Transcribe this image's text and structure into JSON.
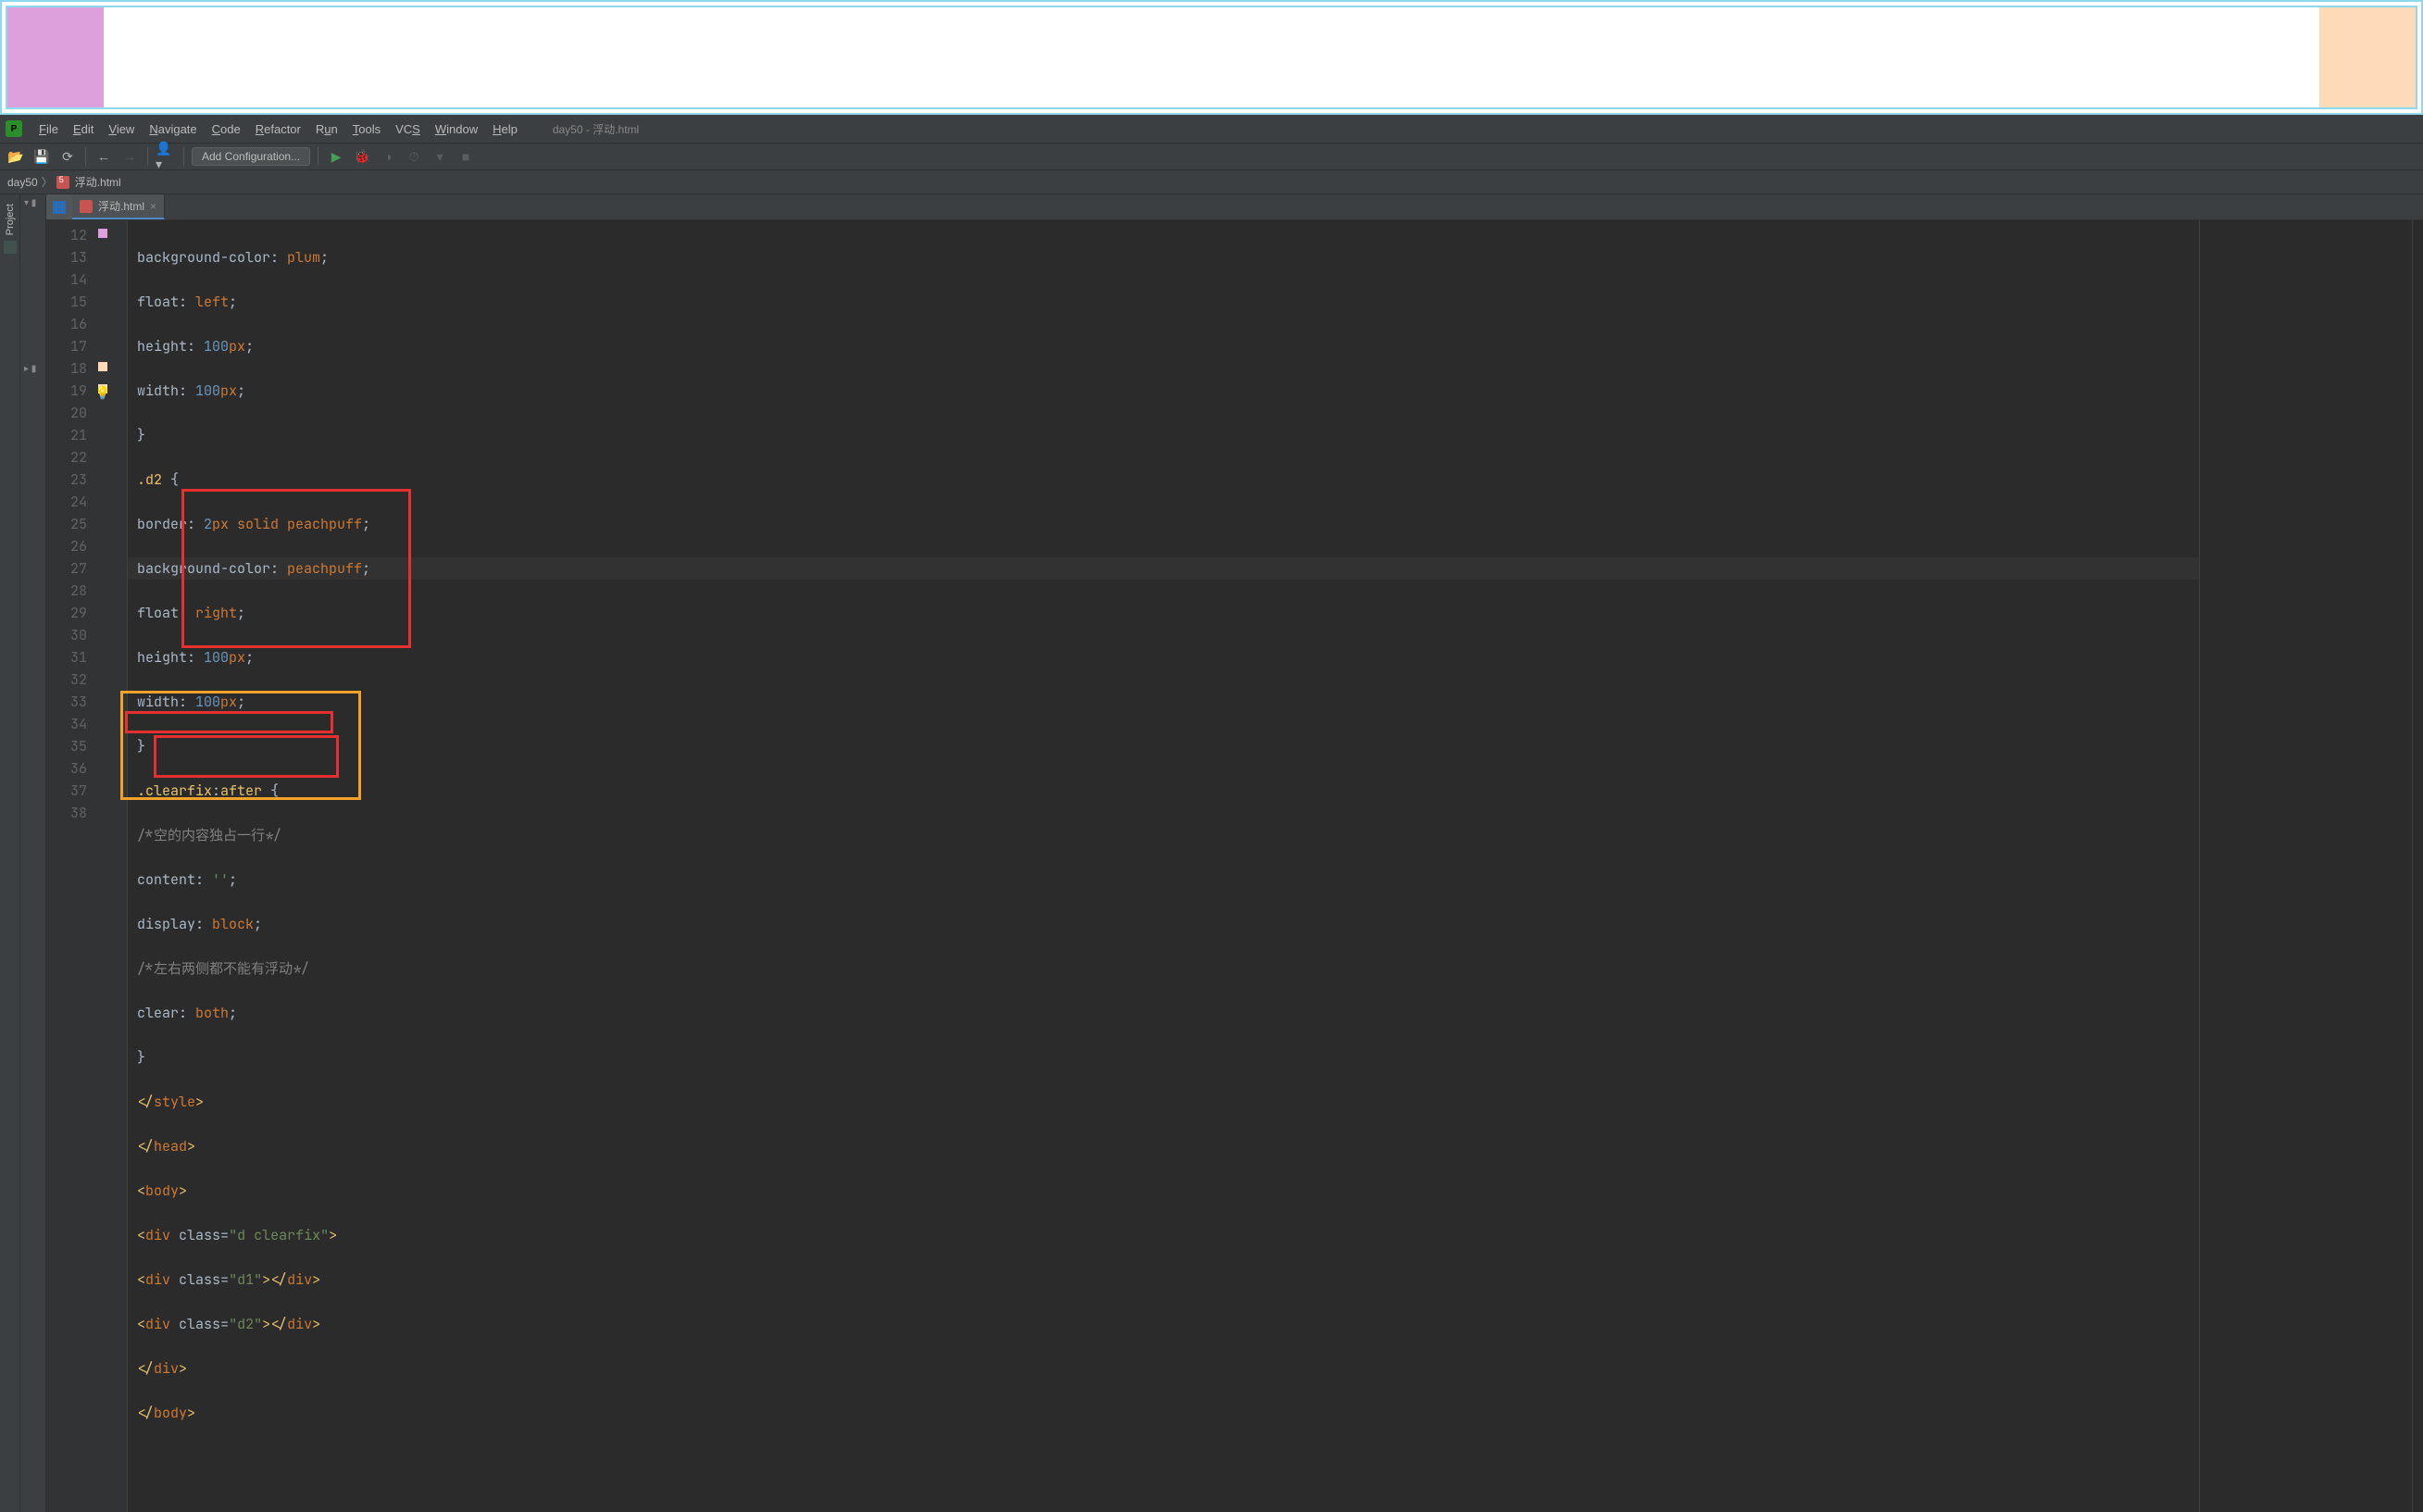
{
  "preview": {
    "plum_color": "#dda0dd",
    "peach_color": "#ffdab9"
  },
  "menubar": {
    "items": [
      "File",
      "Edit",
      "View",
      "Navigate",
      "Code",
      "Refactor",
      "Run",
      "Tools",
      "VCS",
      "Window",
      "Help"
    ],
    "title": "day50 - 浮动.html"
  },
  "toolbar": {
    "config_label": "Add Configuration..."
  },
  "breadcrumb": {
    "root": "day50",
    "file": "浮动.html"
  },
  "sidebar": {
    "project_label": "Project"
  },
  "tabs": {
    "active": "浮动.html"
  },
  "gutter": {
    "start": 12,
    "end": 38
  },
  "code": {
    "l12": "            background-color: plum;",
    "l13": "            float: left;",
    "l14": "            height: 100px;",
    "l15": "            width: 100px;",
    "l16": "        }",
    "l17": "        .d2 {",
    "l18": "            border: 2px solid peachpuff;",
    "l19": "            background-color: peachpuff;",
    "l20": "            float: right;",
    "l21": "            height: 100px;",
    "l22": "            width: 100px;",
    "l23": "        }",
    "l24": "        .clearfix:after {",
    "l25": "             /*空的内容独占一行*/",
    "l26": "             content: '';",
    "l27": "             display: block;",
    "l28": "             /*左右两侧都不能有浮动*/",
    "l29": "             clear: both;",
    "l30": "        }",
    "l31": "    </style>",
    "l32": "</head>",
    "l33": "<body>",
    "l34": "<div class=\"d clearfix\">",
    "l35": "    <div class=\"d1\"></div>",
    "l36": "    <div class=\"d2\"></div>",
    "l37": "</div>",
    "l38": "</body>"
  }
}
